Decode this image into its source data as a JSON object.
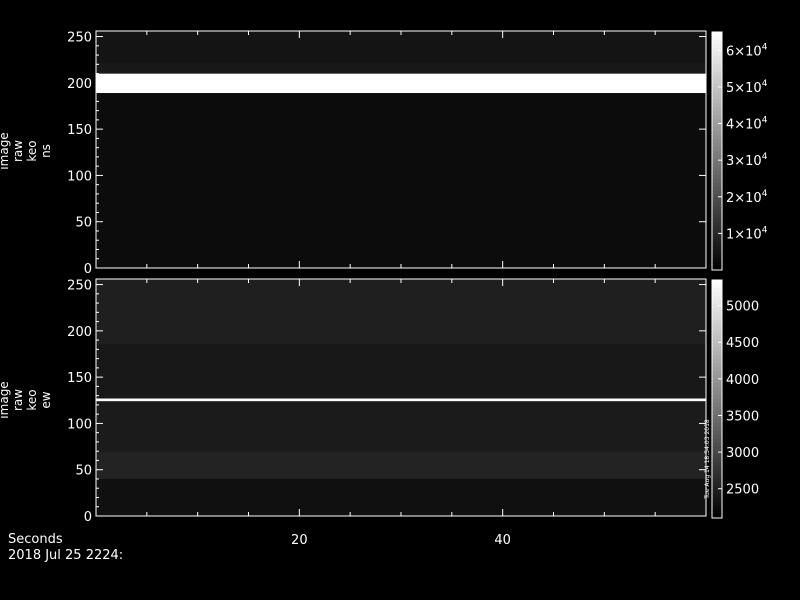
{
  "chart_data": [
    {
      "type": "heatmap",
      "ylabel_lines": [
        "image",
        "raw",
        "keo",
        "ns"
      ],
      "y_ticks": [
        "0",
        "50",
        "100",
        "150",
        "200",
        "250"
      ],
      "y_tick_values": [
        0,
        50,
        100,
        150,
        200,
        250
      ],
      "ylim": [
        0,
        256
      ],
      "xlim": [
        0,
        60
      ],
      "colorbar": {
        "range": [
          0,
          65000
        ],
        "ticks": [
          {
            "value": 10000,
            "mantissa": "1",
            "exp": "4"
          },
          {
            "value": 20000,
            "mantissa": "2",
            "exp": "4"
          },
          {
            "value": 30000,
            "mantissa": "3",
            "exp": "4"
          },
          {
            "value": 40000,
            "mantissa": "4",
            "exp": "4"
          },
          {
            "value": 50000,
            "mantissa": "5",
            "exp": "4"
          },
          {
            "value": 60000,
            "mantissa": "6",
            "exp": "4"
          }
        ]
      },
      "bands": [
        {
          "y0": 0,
          "y1": 189,
          "value": 3000
        },
        {
          "y0": 189,
          "y1": 210,
          "value": 65000
        },
        {
          "y0": 210,
          "y1": 222,
          "value": 6000
        },
        {
          "y0": 222,
          "y1": 256,
          "value": 5000
        }
      ]
    },
    {
      "type": "heatmap",
      "ylabel_lines": [
        "image",
        "raw",
        "keo",
        "ew"
      ],
      "y_ticks": [
        "0",
        "50",
        "100",
        "150",
        "200",
        "250"
      ],
      "y_tick_values": [
        0,
        50,
        100,
        150,
        200,
        250
      ],
      "ylim": [
        0,
        256
      ],
      "xlim": [
        0,
        60
      ],
      "colorbar": {
        "range": [
          2100,
          5350
        ],
        "ticks": [
          {
            "value": 2500,
            "label": "2500"
          },
          {
            "value": 3000,
            "label": "3000"
          },
          {
            "value": 3500,
            "label": "3500"
          },
          {
            "value": 4000,
            "label": "4000"
          },
          {
            "value": 4500,
            "label": "4500"
          },
          {
            "value": 5000,
            "label": "5000"
          }
        ],
        "side_label": "Tue Aug 14 18:54:03 2018"
      },
      "bands": [
        {
          "y0": 0,
          "y1": 40,
          "value": 2300
        },
        {
          "y0": 40,
          "y1": 70,
          "value": 2550
        },
        {
          "y0": 70,
          "y1": 124,
          "value": 2450
        },
        {
          "y0": 124,
          "y1": 127,
          "value": 5300
        },
        {
          "y0": 127,
          "y1": 185,
          "value": 2400
        },
        {
          "y0": 185,
          "y1": 256,
          "value": 2500
        }
      ]
    }
  ],
  "x_axis": {
    "label": "Seconds",
    "ticks": [
      "20",
      "40"
    ],
    "tick_values": [
      20,
      40
    ]
  },
  "footer_date": "2018 Jul 25 2224:"
}
